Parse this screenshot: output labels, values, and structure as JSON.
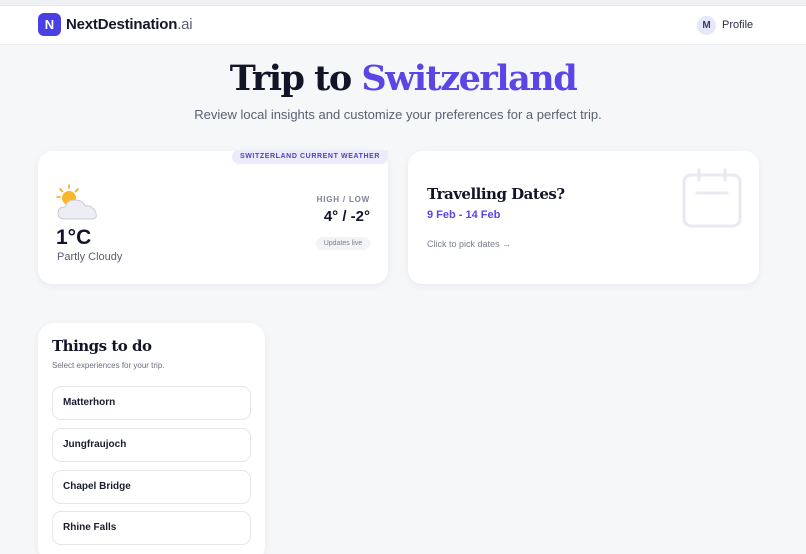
{
  "header": {
    "logo_letter": "N",
    "brand_name": "NextDestination",
    "brand_suffix": ".ai",
    "profile_initial": "M",
    "profile_label": "Profile"
  },
  "hero": {
    "title_prefix": "Trip to ",
    "title_destination": "Switzerland",
    "subtitle": "Review local insights and customize your preferences for a perfect trip."
  },
  "weather": {
    "tag": "SWITZERLAND CURRENT WEATHER",
    "icon": "partly-cloudy-icon",
    "temperature": "1°C",
    "condition": "Partly Cloudy",
    "high_low_label": "HIGH / LOW",
    "high_low_value": "4° / -2°",
    "updates_label": "Updates live"
  },
  "dates": {
    "title": "Travelling Dates?",
    "range": "9 Feb - 14 Feb",
    "hint": "Click to pick dates",
    "hint_icon": "arrow-right-icon",
    "icon": "calendar-icon"
  },
  "todo": {
    "title": "Things to do",
    "subtitle": "Select experiences for your trip.",
    "items": [
      {
        "label": "Matterhorn"
      },
      {
        "label": "Jungfraujoch"
      },
      {
        "label": "Chapel Bridge"
      },
      {
        "label": "Rhine Falls"
      }
    ]
  },
  "colors": {
    "accent": "#5a46e6",
    "logo_bg": "#4a3fe0",
    "background": "#f6f7f9"
  }
}
